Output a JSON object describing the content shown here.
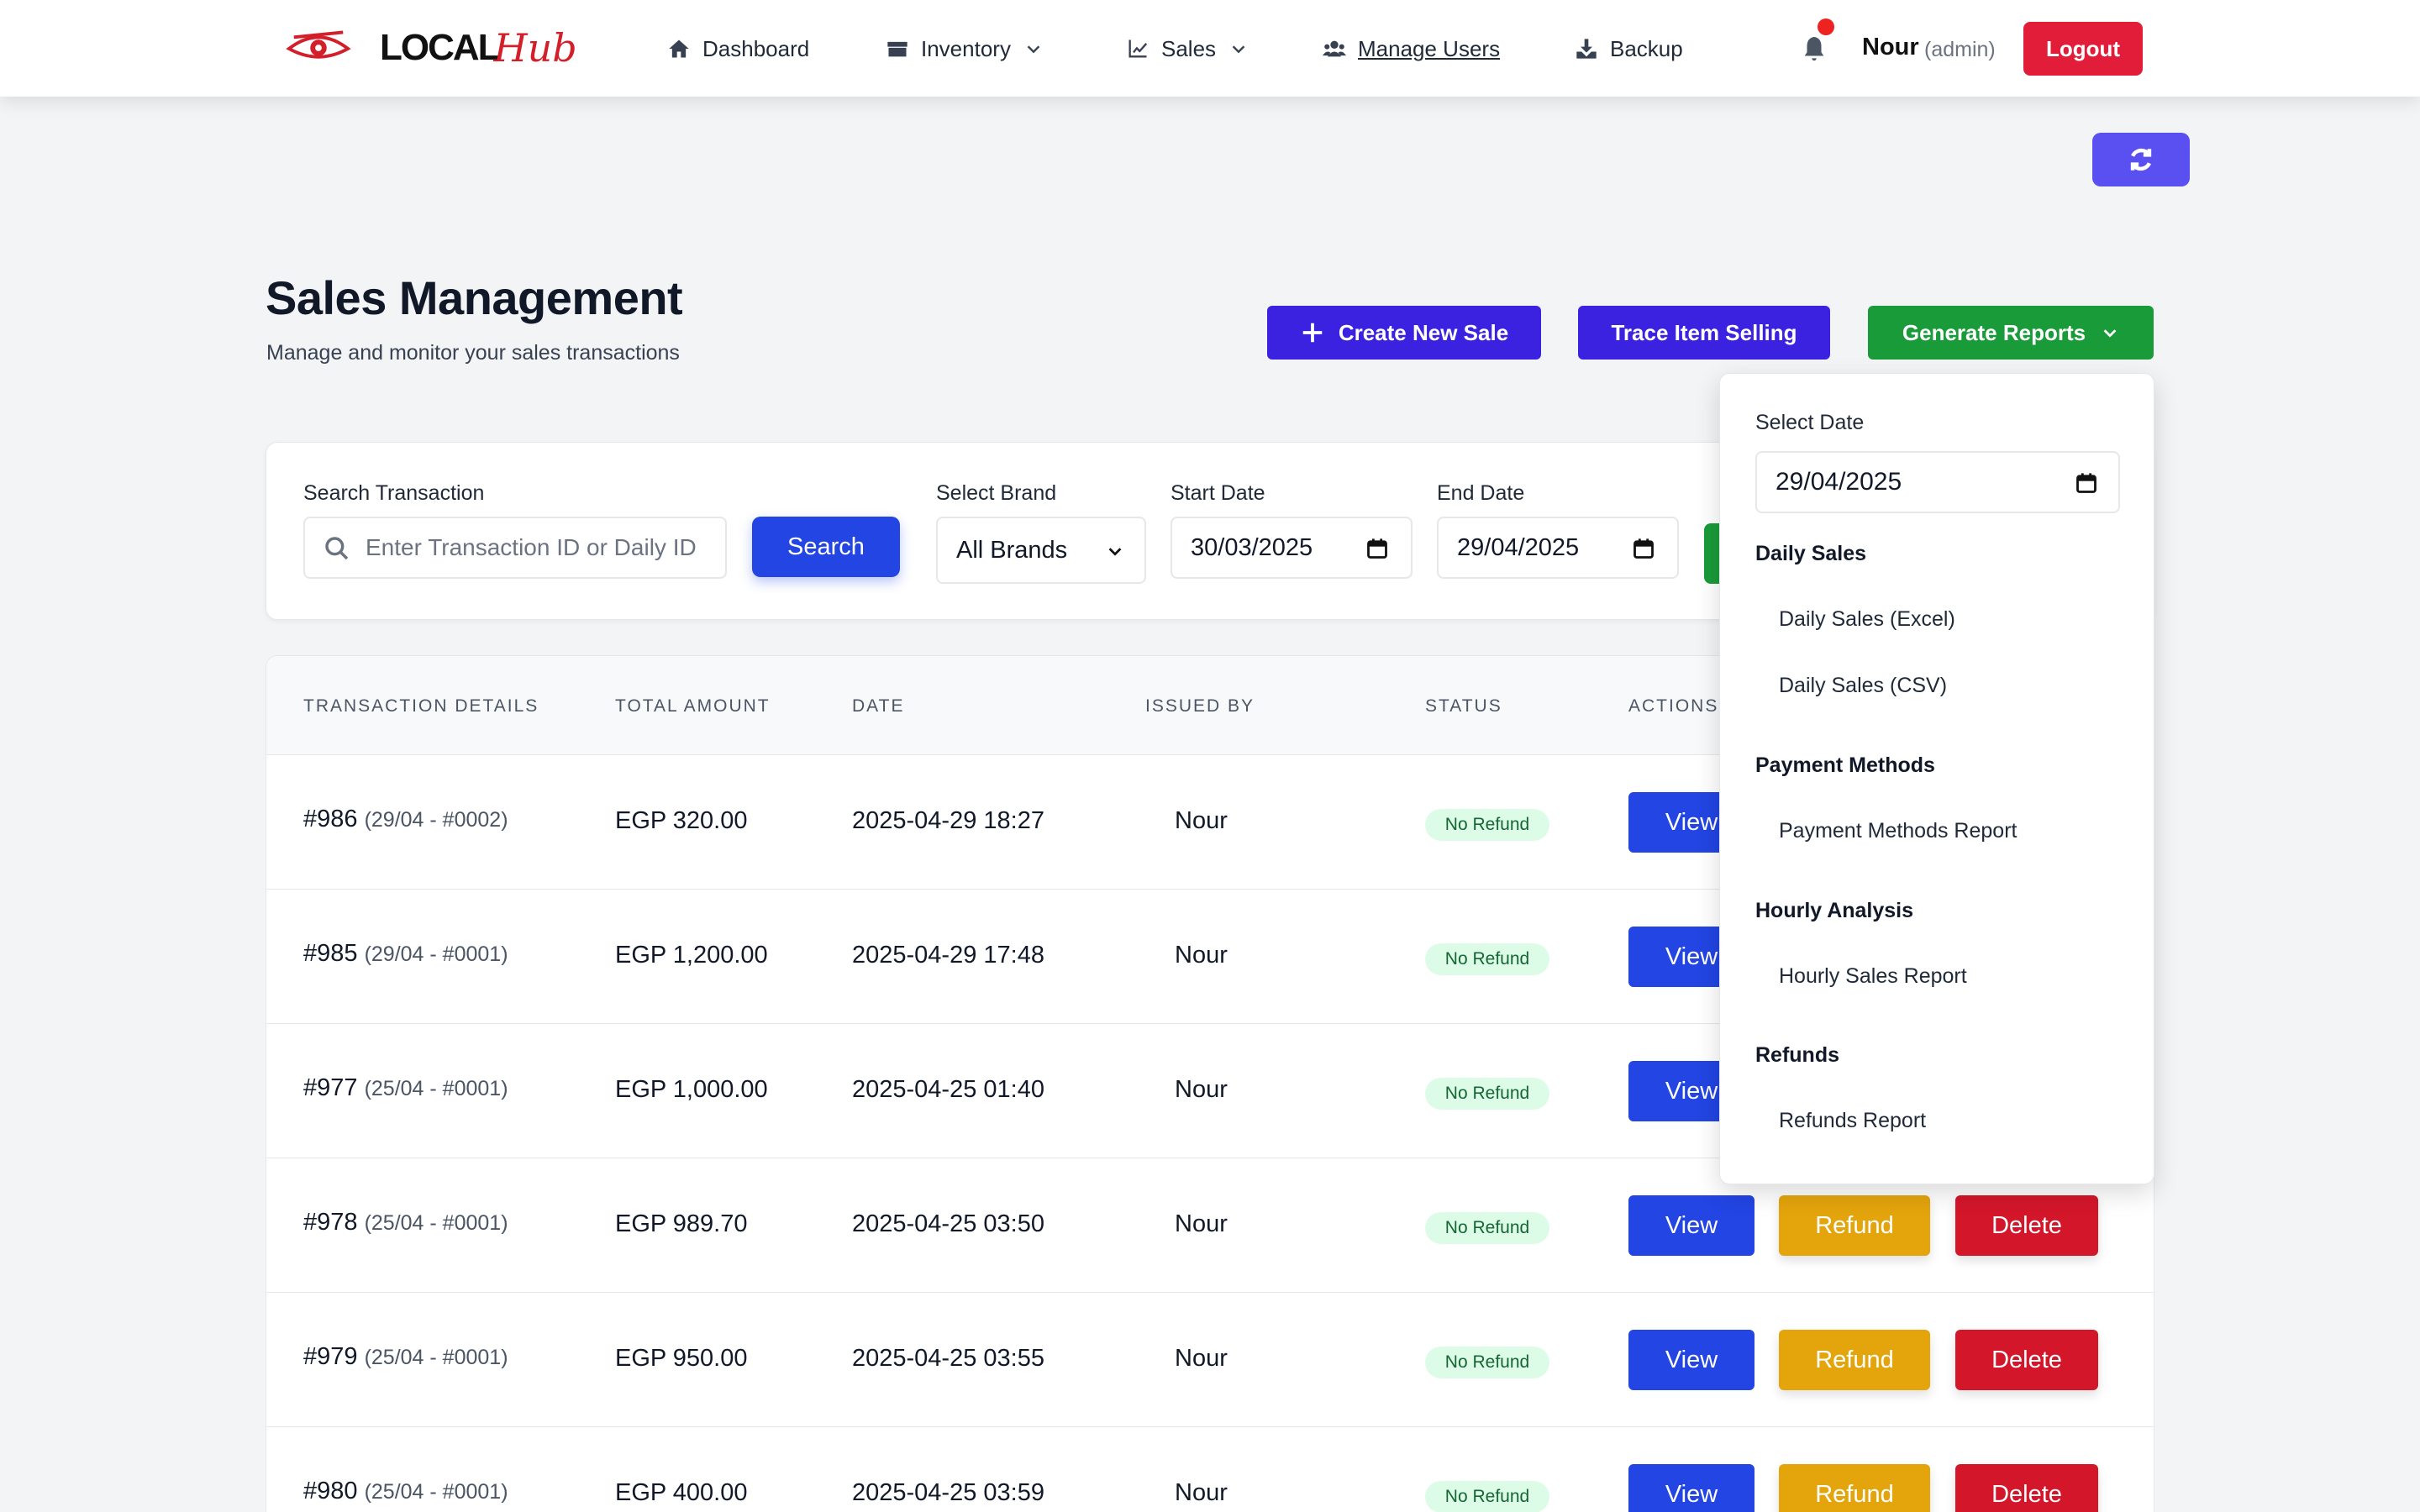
{
  "nav": {
    "logo_text": "LOCAL",
    "logo_script": "Hub",
    "items": [
      {
        "label": "Dashboard"
      },
      {
        "label": "Inventory"
      },
      {
        "label": "Sales"
      },
      {
        "label": "Manage Users"
      },
      {
        "label": "Backup"
      }
    ],
    "user_name": "Nour",
    "user_role": "(admin)",
    "logout_label": "Logout"
  },
  "header": {
    "title": "Sales Management",
    "subtitle": "Manage and monitor your sales transactions",
    "create_label": "Create New Sale",
    "trace_label": "Trace Item Selling",
    "reports_label": "Generate Reports"
  },
  "filters": {
    "search_label": "Search Transaction",
    "search_placeholder": "Enter Transaction ID or Daily ID",
    "search_button": "Search",
    "brand_label": "Select Brand",
    "brand_value": "All Brands",
    "start_label": "Start Date",
    "start_value": "30/03/2025",
    "end_label": "End Date",
    "end_value": "29/04/2025"
  },
  "table": {
    "headers": [
      "TRANSACTION DETAILS",
      "TOTAL AMOUNT",
      "DATE",
      "ISSUED BY",
      "STATUS",
      "ACTIONS"
    ],
    "action_labels": {
      "view": "View",
      "refund": "Refund",
      "delete": "Delete"
    },
    "rows": [
      {
        "id": "#986",
        "sub": "(29/04 - #0002)",
        "amount": "EGP 320.00",
        "date": "2025-04-29 18:27",
        "issued_by": "Nour",
        "status": "No Refund"
      },
      {
        "id": "#985",
        "sub": "(29/04 - #0001)",
        "amount": "EGP 1,200.00",
        "date": "2025-04-29 17:48",
        "issued_by": "Nour",
        "status": "No Refund"
      },
      {
        "id": "#977",
        "sub": "(25/04 - #0001)",
        "amount": "EGP 1,000.00",
        "date": "2025-04-25 01:40",
        "issued_by": "Nour",
        "status": "No Refund"
      },
      {
        "id": "#978",
        "sub": "(25/04 - #0001)",
        "amount": "EGP 989.70",
        "date": "2025-04-25 03:50",
        "issued_by": "Nour",
        "status": "No Refund"
      },
      {
        "id": "#979",
        "sub": "(25/04 - #0001)",
        "amount": "EGP 950.00",
        "date": "2025-04-25 03:55",
        "issued_by": "Nour",
        "status": "No Refund"
      },
      {
        "id": "#980",
        "sub": "(25/04 - #0001)",
        "amount": "EGP 400.00",
        "date": "2025-04-25 03:59",
        "issued_by": "Nour",
        "status": "No Refund"
      }
    ]
  },
  "reports_dropdown": {
    "select_date_label": "Select Date",
    "date_value": "29/04/2025",
    "sections": [
      {
        "title": "Daily Sales",
        "items": [
          "Daily Sales (Excel)",
          "Daily Sales (CSV)"
        ]
      },
      {
        "title": "Payment Methods",
        "items": [
          "Payment Methods Report"
        ]
      },
      {
        "title": "Hourly Analysis",
        "items": [
          "Hourly Sales Report"
        ]
      },
      {
        "title": "Refunds",
        "items": [
          "Refunds Report"
        ]
      }
    ]
  },
  "colors": {
    "primary_indigo": "#3a22e0",
    "primary_blue": "#2245e3",
    "success_green": "#1a9b3a",
    "danger_red": "#d3162a",
    "warning_amber": "#e3a40c",
    "refresh_violet": "#5a4ff0"
  }
}
